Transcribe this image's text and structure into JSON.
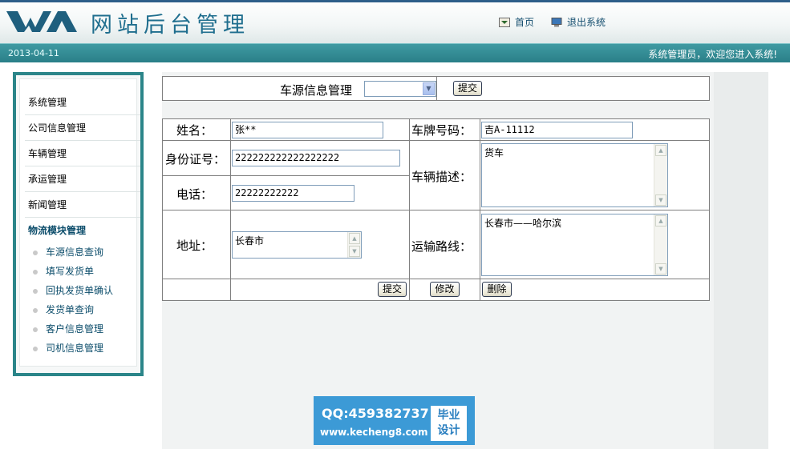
{
  "header": {
    "title": "网站后台管理",
    "home_label": "首页",
    "logout_label": "退出系统",
    "date": "2013-04-11",
    "welcome": "系统管理员，欢迎您进入系统!"
  },
  "sidebar": {
    "items": [
      "系统管理",
      "公司信息管理",
      "车辆管理",
      "承运管理",
      "新闻管理"
    ],
    "section_title": "物流模块管理",
    "subitems": [
      "车源信息查询",
      "填写发货单",
      "回执发货单确认",
      "发货单查询",
      "客户信息管理",
      "司机信息管理"
    ]
  },
  "toolbar": {
    "label": "车源信息管理",
    "select_value": "",
    "submit_label": "提交"
  },
  "form": {
    "name_label": "姓名：",
    "name_value": "张**",
    "plate_label": "车牌号码：",
    "plate_value": "吉A-11112",
    "id_label": "身份证号：",
    "id_value": "222222222222222222",
    "vehicle_desc_label": "车辆描述：",
    "vehicle_desc_value": "货车",
    "phone_label": "电话：",
    "phone_value": "22222222222",
    "address_label": "地址：",
    "address_value": "长春市",
    "route_label": "运输路线：",
    "route_value": "长春市——哈尔滨",
    "submit_label": "提交",
    "modify_label": "修改",
    "delete_label": "删除"
  },
  "badge": {
    "qq": "QQ:459382737",
    "url": "www.kecheng8.com",
    "tag_line1": "毕业",
    "tag_line2": "设计"
  },
  "colors": {
    "header_title": "#1f6e8e",
    "statusbar": "#2a7f88",
    "sidebar_border": "#2b8589",
    "badge": "#3c9ad6"
  }
}
